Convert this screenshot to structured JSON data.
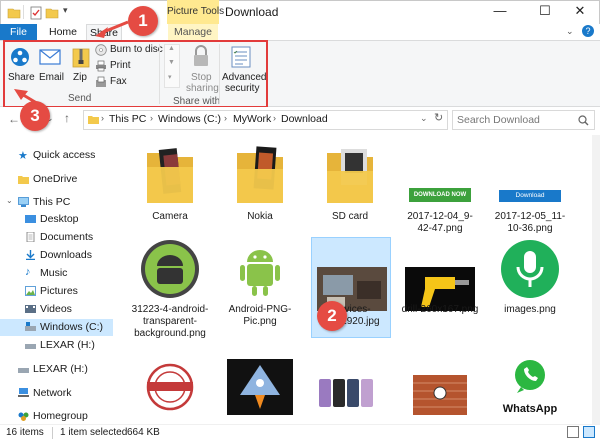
{
  "window": {
    "title": "Download",
    "context_tab_group": "Picture Tools",
    "controls": {
      "minimize": "—",
      "maximize": "☐",
      "close": "✕"
    }
  },
  "ribbon": {
    "tabs": {
      "file": "File",
      "home": "Home",
      "share": "Share",
      "manage": "Manage"
    },
    "send_group": {
      "label": "Send",
      "share": "Share",
      "email": "Email",
      "zip": "Zip",
      "burn": "Burn to disc",
      "print": "Print",
      "fax": "Fax"
    },
    "share_with_group": {
      "label": "Share with",
      "stop_sharing_line1": "Stop",
      "stop_sharing_line2": "sharing"
    },
    "advanced_security_line1": "Advanced",
    "advanced_security_line2": "security"
  },
  "address": {
    "crumbs": [
      "This PC",
      "Windows (C:)",
      "MyWork",
      "Download"
    ],
    "search_placeholder": "Search Download"
  },
  "nav": {
    "items": [
      {
        "label": "Quick access"
      },
      {
        "label": "OneDrive"
      },
      {
        "label": "This PC"
      },
      {
        "label": "Desktop"
      },
      {
        "label": "Documents"
      },
      {
        "label": "Downloads"
      },
      {
        "label": "Music"
      },
      {
        "label": "Pictures"
      },
      {
        "label": "Videos"
      },
      {
        "label": "Windows (C:)"
      },
      {
        "label": "LEXAR (H:)"
      },
      {
        "label": "LEXAR (H:)"
      },
      {
        "label": "Network"
      },
      {
        "label": "Homegroup"
      }
    ]
  },
  "files": [
    {
      "name": "Camera"
    },
    {
      "name": "Nokia"
    },
    {
      "name": "SD card"
    },
    {
      "name": "2017-12-04_9-42-47.png"
    },
    {
      "name": "2017-12-05_11-10-36.png"
    },
    {
      "name": "31223-4-android-transparent-background.png"
    },
    {
      "name": "Android-PNG-Pic.png"
    },
    {
      "name": "devices-28_1920.jpg"
    },
    {
      "name": "drill-260x167.png"
    },
    {
      "name": "images.png"
    }
  ],
  "thumb_text": {
    "download_now": "DOWNLOAD NOW",
    "download": "Download",
    "whatsapp": "WhatsApp"
  },
  "status": {
    "count": "16 items",
    "selected": "1 item selected",
    "size": "664 KB"
  },
  "markers": {
    "m1": "1",
    "m2": "2",
    "m3": "3"
  },
  "colors": {
    "accent": "#1979ca",
    "marker": "#e54b43",
    "selection": "#cce8ff",
    "folder": "#f3c94c"
  }
}
